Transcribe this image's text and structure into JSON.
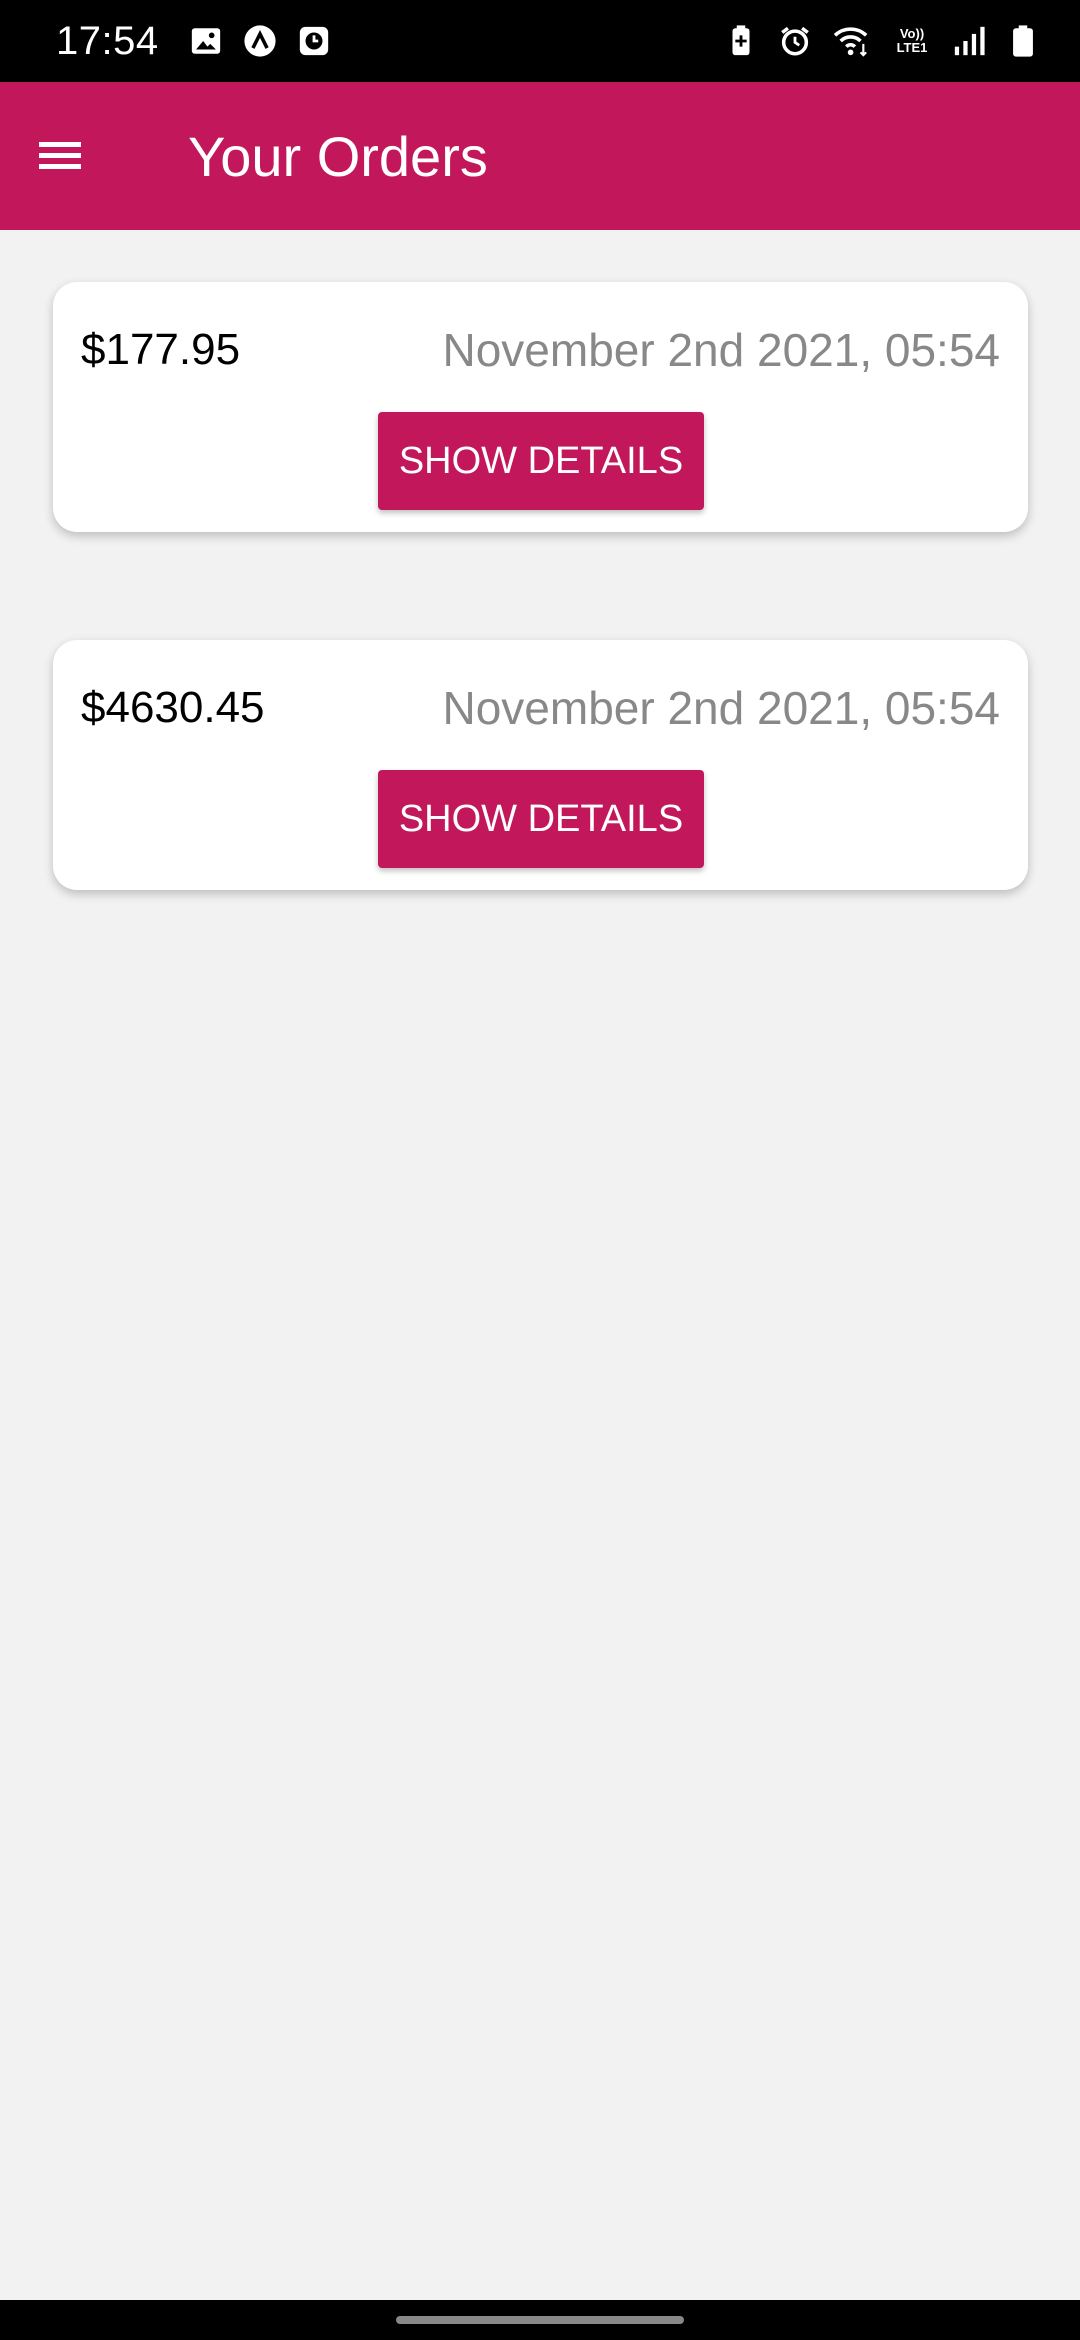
{
  "status_bar": {
    "time": "17:54",
    "left_icons": [
      "gallery-icon",
      "app-a-icon",
      "clock-app-icon"
    ],
    "right_icons": [
      "battery-saver-icon",
      "alarm-icon",
      "wifi-icon",
      "volte-icon",
      "signal-icon",
      "battery-icon"
    ],
    "volte_text": "Vo))",
    "lte_text": "LTE1"
  },
  "app_bar": {
    "title": "Your Orders",
    "color": "#c2185b"
  },
  "orders": [
    {
      "amount": "$177.95",
      "date": "November 2nd 2021, 05:54",
      "button_label": "SHOW DETAILS"
    },
    {
      "amount": "$4630.45",
      "date": "November 2nd 2021, 05:54",
      "button_label": "SHOW DETAILS"
    }
  ]
}
